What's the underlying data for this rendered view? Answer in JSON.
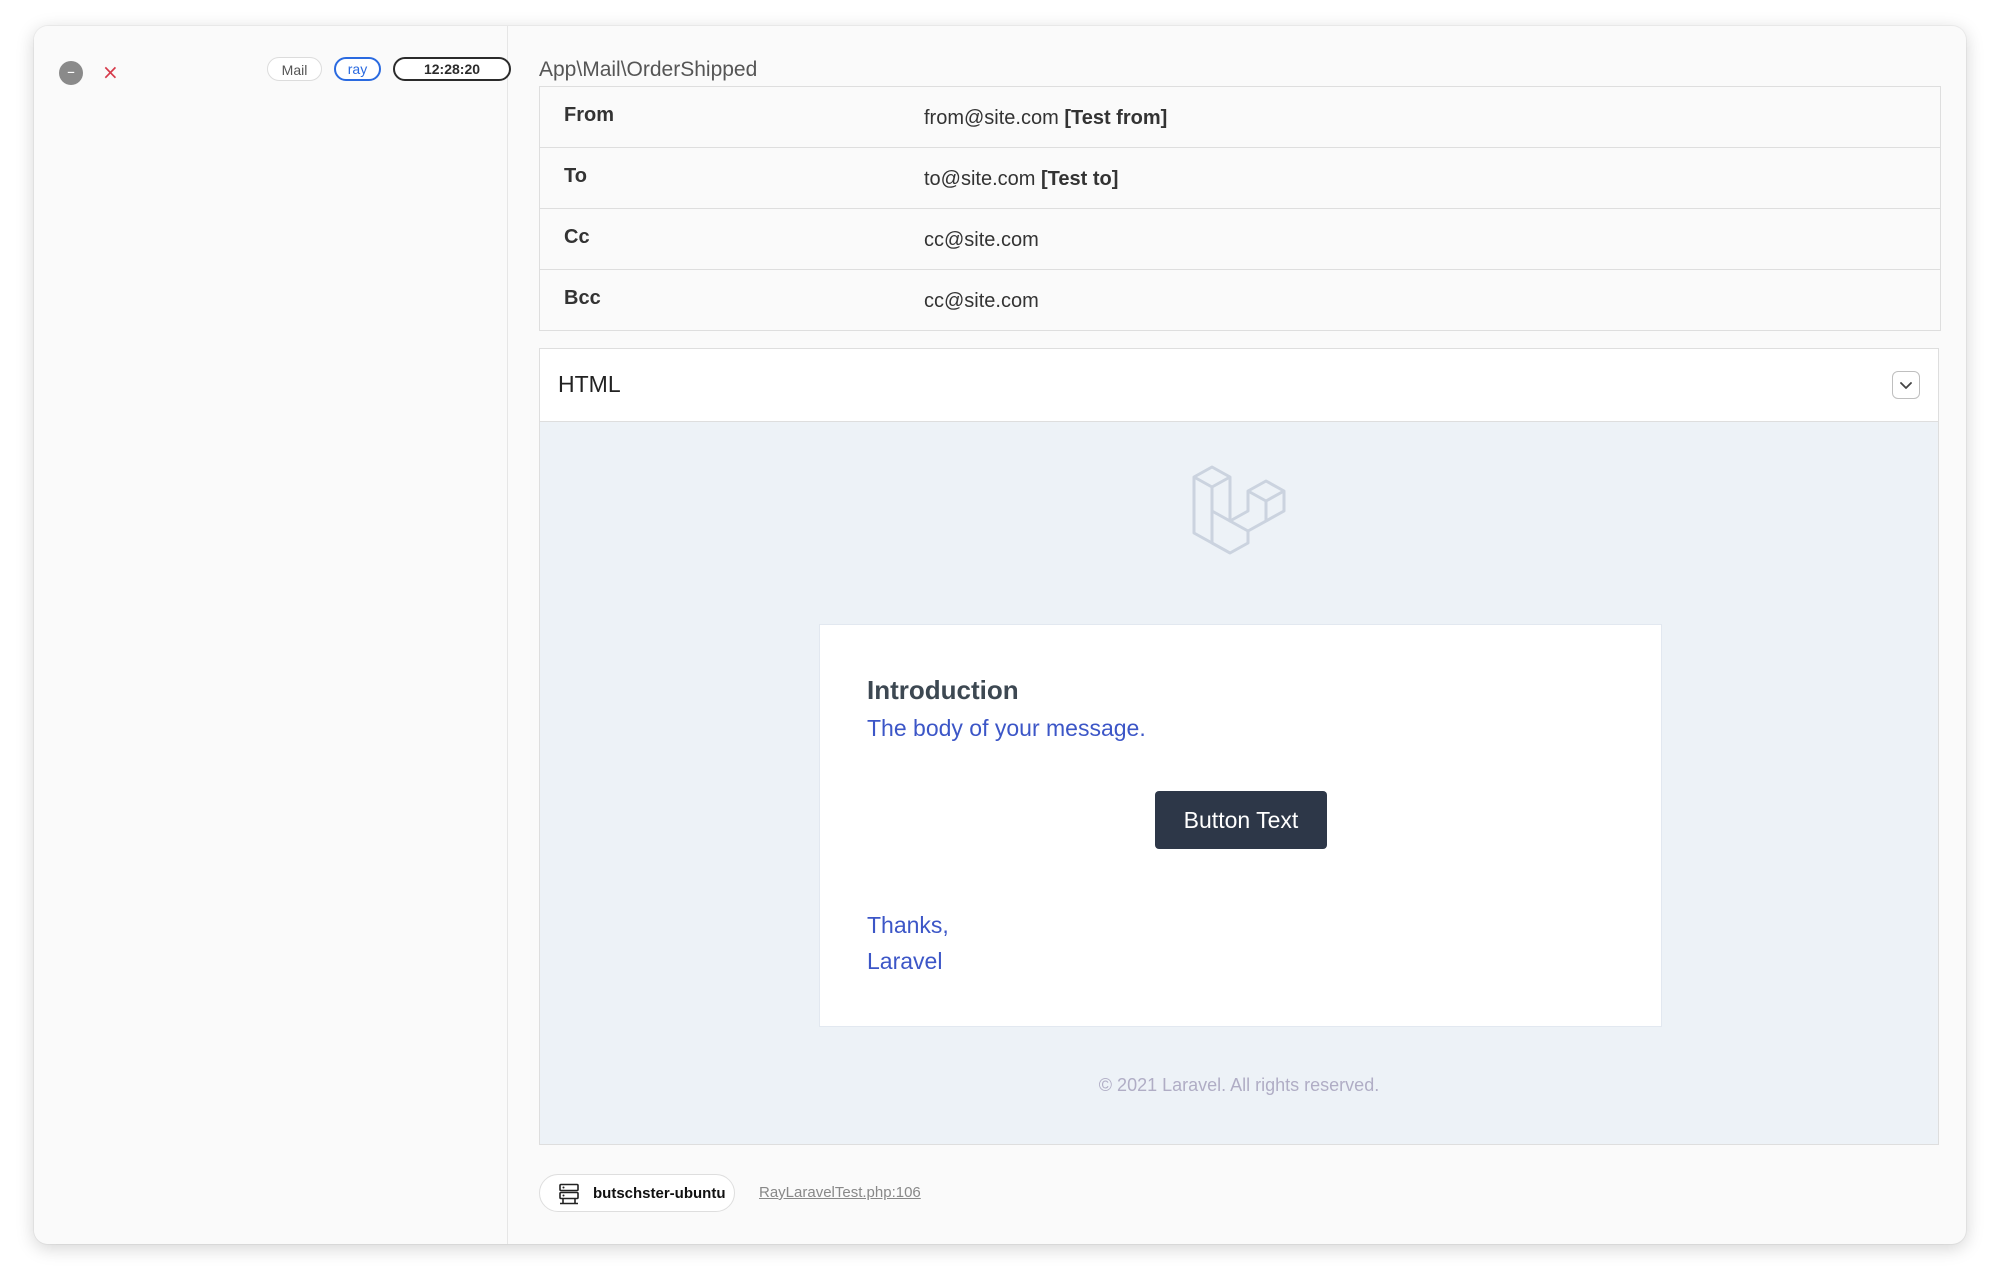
{
  "controls": {
    "minimize": "–",
    "close": "×"
  },
  "tags": {
    "type": "Mail",
    "ray": "ray",
    "time": "12:28:20"
  },
  "mail": {
    "class_name": "App\\Mail\\OrderShipped",
    "headers": [
      {
        "key": "From",
        "value": "from@site.com",
        "name": "[Test from]"
      },
      {
        "key": "To",
        "value": "to@site.com",
        "name": "[Test to]"
      },
      {
        "key": "Cc",
        "value": "cc@site.com",
        "name": ""
      },
      {
        "key": "Bcc",
        "value": "cc@site.com",
        "name": ""
      }
    ],
    "panel_title": "HTML",
    "preview": {
      "heading": "Introduction",
      "body": "The body of your message.",
      "button": "Button Text",
      "thanks": "Thanks,",
      "signature": "Laravel",
      "footer": "© 2021 Laravel. All rights reserved."
    }
  },
  "origin": {
    "hostname": "butschster-ubuntu",
    "source": "RayLaravelTest.php:106"
  },
  "colors": {
    "ray_blue": "#2a6ae0",
    "close_red": "#d63a4a",
    "button_bg": "#2d3748",
    "link_blue": "#3c56c7"
  }
}
